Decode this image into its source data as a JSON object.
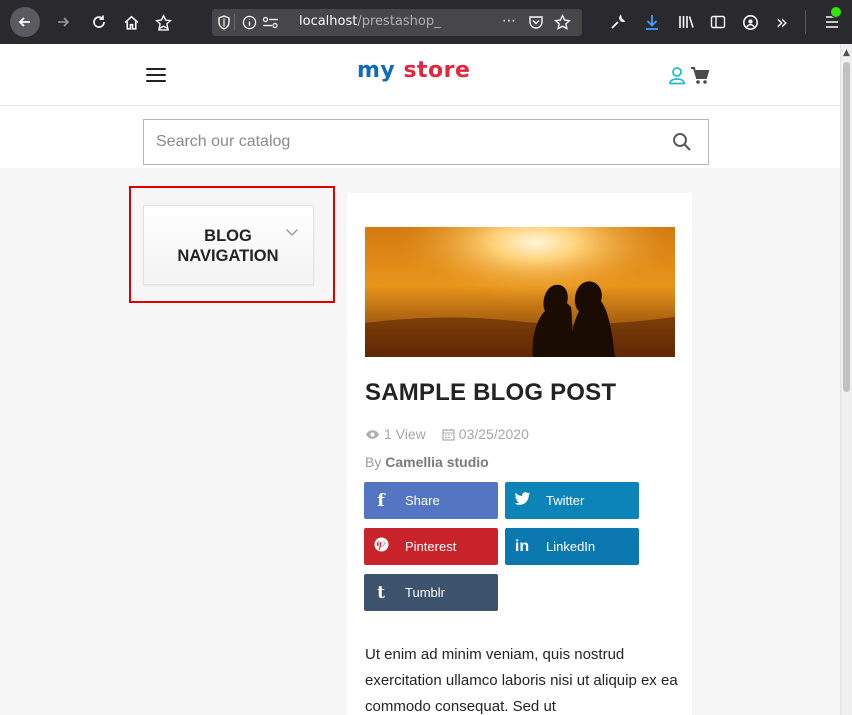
{
  "browser": {
    "url_host": "localhost",
    "url_path": "/prestashop_",
    "more": "⋯",
    "overflow": "»"
  },
  "header": {
    "logo": [
      "my",
      " ",
      "store"
    ],
    "logo_colors": [
      "#0e6bb8",
      "#232323",
      "#e0293f"
    ]
  },
  "search": {
    "placeholder": "Search our catalog"
  },
  "sidebar": {
    "blog_nav_title": "BLOG NAVIGATION"
  },
  "post": {
    "title": "SAMPLE BLOG POST",
    "views": "1 View",
    "date": "03/25/2020",
    "author_prefix": "By",
    "author": "Camellia studio",
    "share_buttons": [
      {
        "label": "Share",
        "icon": "facebook-icon",
        "glyph": "f",
        "color": "#5476c2"
      },
      {
        "label": "Twitter",
        "icon": "twitter-icon",
        "glyph": "✦",
        "color": "#0c84b7"
      },
      {
        "label": "Pinterest",
        "icon": "pinterest-icon",
        "glyph": "P",
        "color": "#c9232c"
      },
      {
        "label": "LinkedIn",
        "icon": "linkedin-icon",
        "glyph": "in",
        "color": "#0b78b0"
      },
      {
        "label": "Tumblr",
        "icon": "tumblr-icon",
        "glyph": "t",
        "color": "#3d526c"
      }
    ],
    "body": "Ut enim ad minim veniam, quis nostrud exercitation ullamco laboris nisi ut aliquip ex ea commodo consequat. Sed ut"
  },
  "colors": {
    "highlight": "#e00000",
    "text": "#232323",
    "meta": "#a6a6a6"
  }
}
